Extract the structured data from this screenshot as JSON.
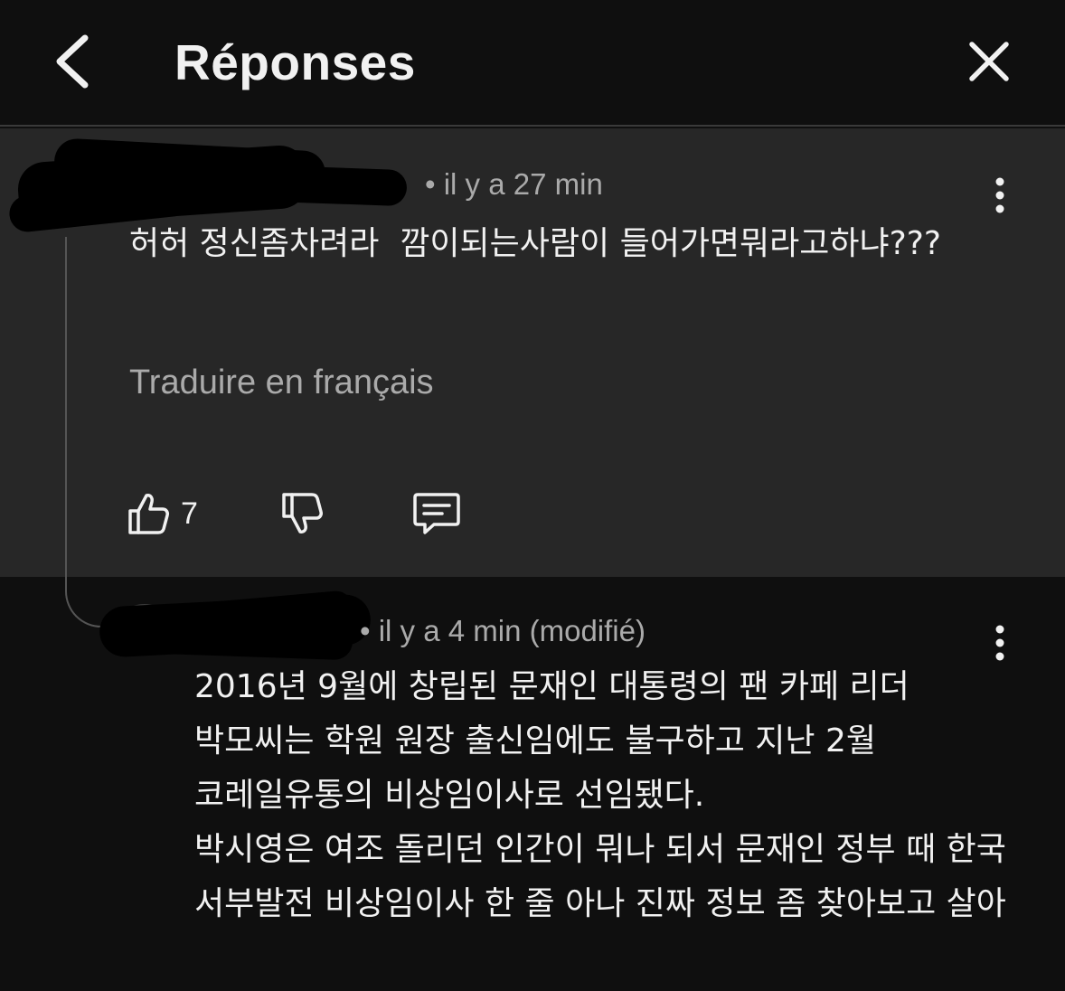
{
  "header": {
    "title": "Réponses",
    "back_icon": "chevron-left-icon",
    "close_icon": "close-icon"
  },
  "comments": [
    {
      "author_redacted": true,
      "timestamp": "• il y a 27 min",
      "text": "허허 정신좀차려라  깜이되는사람이 들어가면뭐라고하냐???",
      "translate_label": "Traduire en français",
      "like_count": "7",
      "highlighted": true
    },
    {
      "author_redacted": true,
      "timestamp": "• il y a 4 min (modifié)",
      "text": "2016년 9월에 창립된 문재인 대통령의 팬 카페 리더 박모씨는 학원 원장 출신임에도 불구하고 지난 2월 코레일유통의 비상임이사로 선임됐다.\n박시영은 여조 돌리던 인간이 뭐나 되서 문재인 정부 때 한국 서부발전 비상임이사 한 줄 아나 진짜 정보 좀 찾아보고 살아"
    }
  ],
  "colors": {
    "background": "#0f0f0f",
    "highlight": "#272727",
    "text_primary": "#f1f1f1",
    "text_secondary": "#aaaaaa"
  }
}
